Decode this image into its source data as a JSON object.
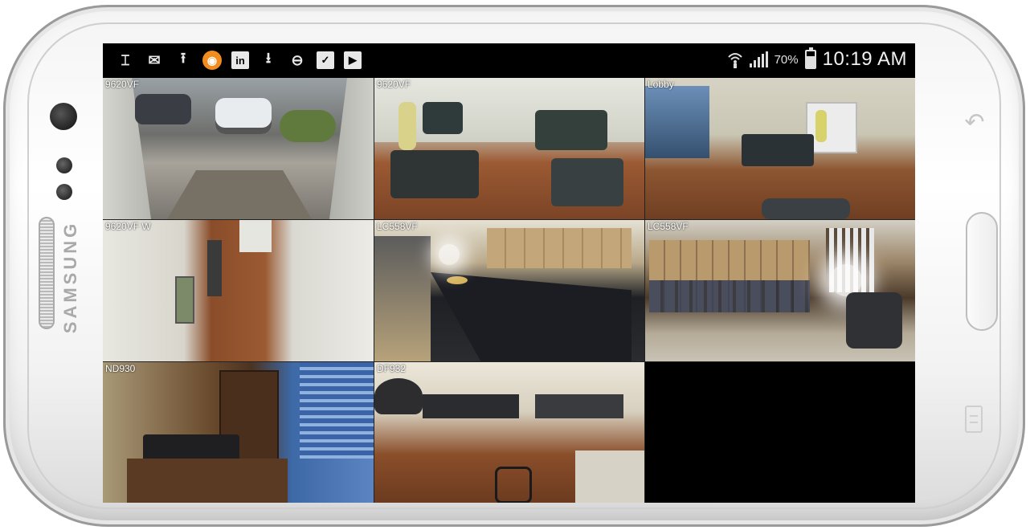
{
  "device": {
    "brand": "SAMSUNG"
  },
  "status_bar": {
    "notification_icons": [
      "text-cursor-icon",
      "mail-icon",
      "upload-icon",
      "orange-app-icon",
      "linkedin-icon",
      "download-icon",
      "do-not-disturb-icon",
      "clipboard-check-icon",
      "shopping-bag-icon"
    ],
    "linkedin_text": "in",
    "battery_percent": "70%",
    "battery_level": 0.7,
    "time": "10:19 AM"
  },
  "cameras": [
    {
      "label": "9620VF",
      "scene": "parking lot"
    },
    {
      "label": "9620VF",
      "scene": "office"
    },
    {
      "label": "Lobby",
      "scene": "office"
    },
    {
      "label": "9620VF W",
      "scene": "hallway"
    },
    {
      "label": "LC558VF",
      "scene": "warehouse"
    },
    {
      "label": "LC558VF",
      "scene": "warehouse"
    },
    {
      "label": "ND930",
      "scene": "office"
    },
    {
      "label": "DF932",
      "scene": "office"
    },
    {
      "label": "",
      "scene": "empty"
    }
  ]
}
